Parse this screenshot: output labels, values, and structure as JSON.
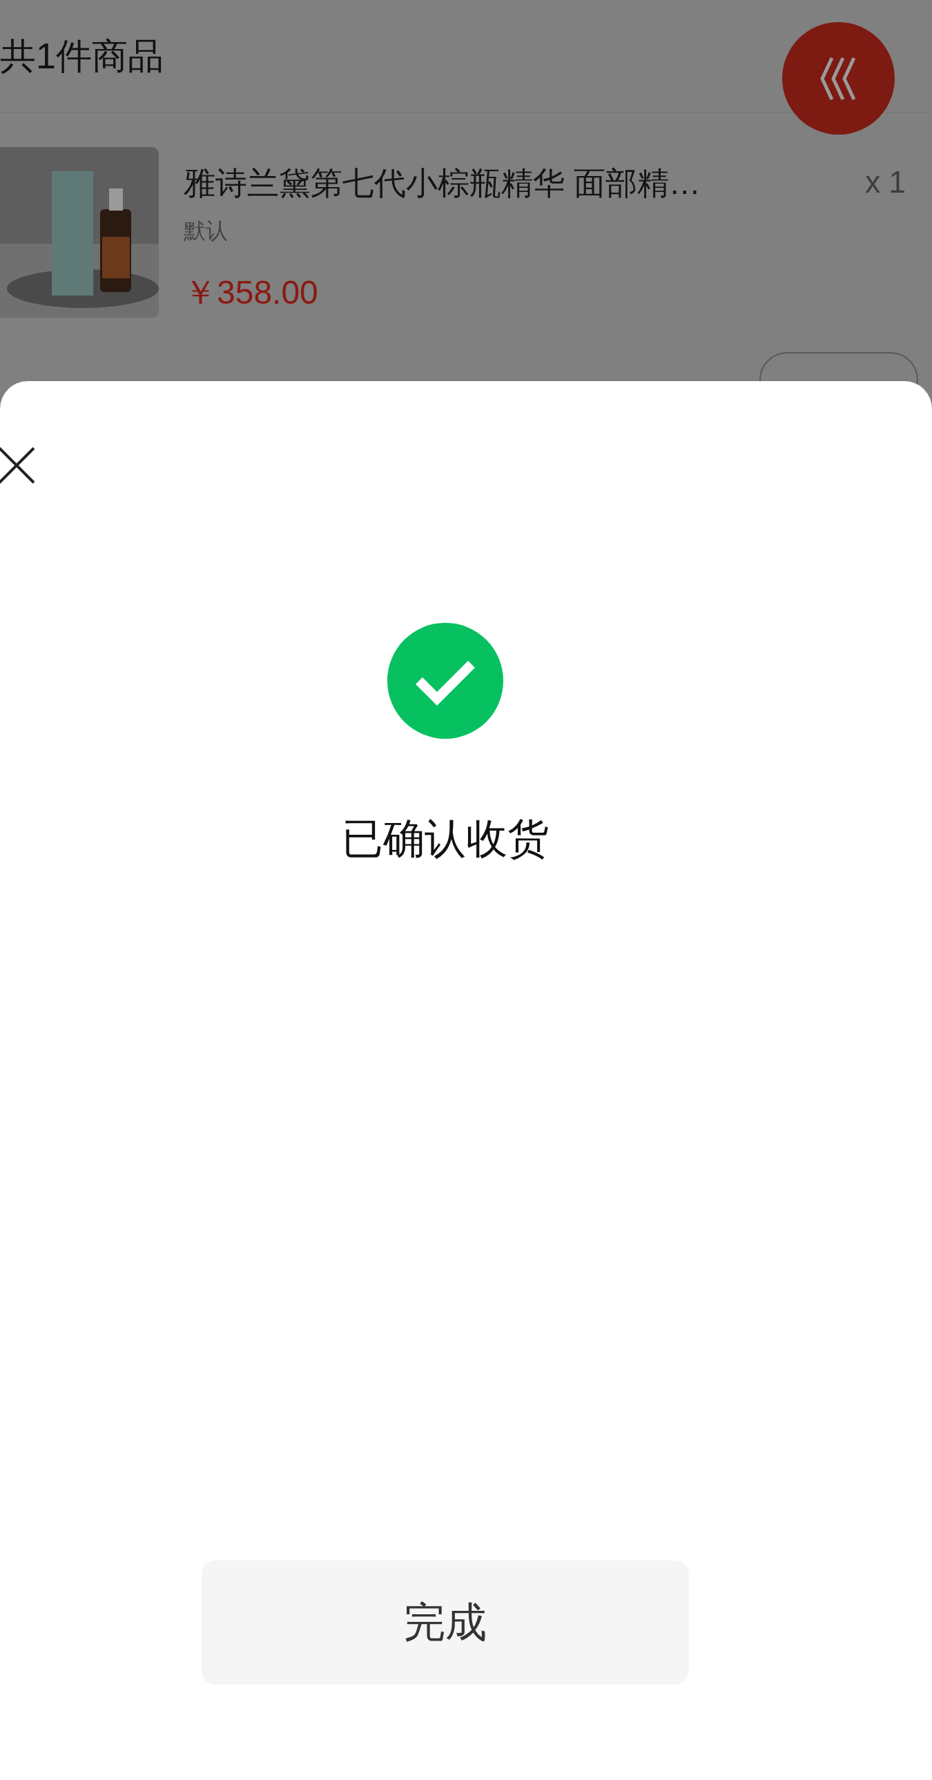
{
  "order": {
    "count_label": "共1件商品",
    "product": {
      "kind": "picture",
      "title": "雅诗兰黛第七代小棕瓶精华 面部精…",
      "variant": "默认",
      "price": "￥358.00",
      "quantity": "x 1"
    }
  },
  "sheet": {
    "message": "已确认收货",
    "done_button": "完成"
  }
}
